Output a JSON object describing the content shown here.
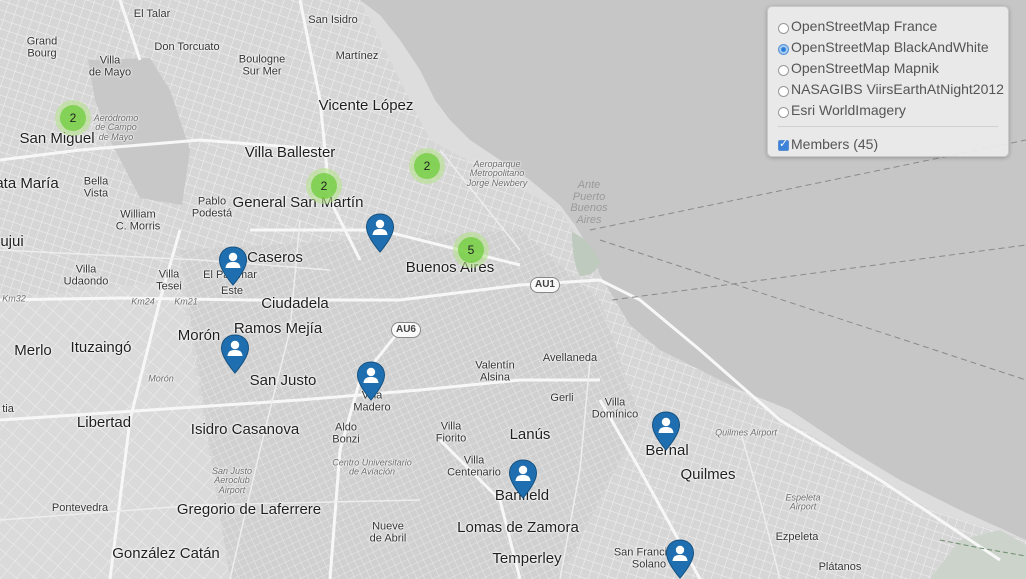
{
  "layers": {
    "base": [
      {
        "label": "OpenStreetMap France",
        "selected": false
      },
      {
        "label": "OpenStreetMap BlackAndWhite",
        "selected": true
      },
      {
        "label": "OpenStreetMap Mapnik",
        "selected": false
      },
      {
        "label": "NASAGIBS ViirsEarthAtNight2012",
        "selected": false
      },
      {
        "label": "Esri WorldImagery",
        "selected": false
      }
    ],
    "overlay": {
      "label": "Members (45)",
      "checked": true
    }
  },
  "map": {
    "places": [
      {
        "text": "El Talar",
        "size": "sm"
      },
      {
        "text": "San Isidro",
        "size": "sm"
      },
      {
        "text": "Grand\nBourg",
        "size": "sm"
      },
      {
        "text": "Don Torcuato",
        "size": "sm"
      },
      {
        "text": "Villa\nde Mayo",
        "size": "sm"
      },
      {
        "text": "Boulogne\nSur Mer",
        "size": "sm"
      },
      {
        "text": "Martínez",
        "size": "sm"
      },
      {
        "text": "Vicente López",
        "size": "lg"
      },
      {
        "text": "Aeródromo\nde Campo\nde Mayo",
        "size": "it"
      },
      {
        "text": "San Miguel",
        "size": "lg"
      },
      {
        "text": "Villa Ballester",
        "size": "lg"
      },
      {
        "text": "Aeroparque\nMetropolitano\nJorge Newbery",
        "size": "it"
      },
      {
        "text": "ata María",
        "size": "lg"
      },
      {
        "text": "Bella\nVista",
        "size": "sm"
      },
      {
        "text": "Pablo\nPodestá",
        "size": "sm"
      },
      {
        "text": "General San Martín",
        "size": "lg"
      },
      {
        "text": "Ante\nPuerto\nBuenos\nAires",
        "size": "water"
      },
      {
        "text": "William\nC. Morris",
        "size": "sm"
      },
      {
        "text": "Caseros",
        "size": "lg"
      },
      {
        "text": "Buenos Aires",
        "size": "lg"
      },
      {
        "text": "ujui",
        "size": "lg"
      },
      {
        "text": "Villa\nUdaondo",
        "size": "sm"
      },
      {
        "text": "Villa\nTesei",
        "size": "sm"
      },
      {
        "text": "El Palomar",
        "size": "sm"
      },
      {
        "text": "Este",
        "size": "sm"
      },
      {
        "text": "Km32",
        "size": "it"
      },
      {
        "text": "Km24",
        "size": "it"
      },
      {
        "text": "Km21",
        "size": "it"
      },
      {
        "text": "Ciudadela",
        "size": "lg"
      },
      {
        "text": "Ramos Mejía",
        "size": "lg"
      },
      {
        "text": "Morón",
        "size": "lg"
      },
      {
        "text": "Merlo",
        "size": "lg"
      },
      {
        "text": "Ituzaingó",
        "size": "lg"
      },
      {
        "text": "Morón",
        "size": "it"
      },
      {
        "text": "San Justo",
        "size": "lg"
      },
      {
        "text": "Valentín\nAlsina",
        "size": "sm"
      },
      {
        "text": "Avellaneda",
        "size": "sm"
      },
      {
        "text": "Villa\nMadero",
        "size": "sm"
      },
      {
        "text": "Gerli",
        "size": "sm"
      },
      {
        "text": "Villa\nDomínico",
        "size": "sm"
      },
      {
        "text": "tia",
        "size": "sm"
      },
      {
        "text": "Libertad",
        "size": "lg"
      },
      {
        "text": "Isidro Casanova",
        "size": "lg"
      },
      {
        "text": "Aldo\nBonzi",
        "size": "sm"
      },
      {
        "text": "Villa\nFiorito",
        "size": "sm"
      },
      {
        "text": "Lanús",
        "size": "lg"
      },
      {
        "text": "Bernal",
        "size": "lg"
      },
      {
        "text": "Quilmes Airport",
        "size": "it"
      },
      {
        "text": "Centro Universitario\nde Aviación",
        "size": "it"
      },
      {
        "text": "Villa\nCentenario",
        "size": "sm"
      },
      {
        "text": "Quilmes",
        "size": "lg"
      },
      {
        "text": "Banfield",
        "size": "lg"
      },
      {
        "text": "San Justo\nAeroclub\nAirport",
        "size": "it"
      },
      {
        "text": "Pontevedra",
        "size": "sm"
      },
      {
        "text": "Gregorio de Laferrere",
        "size": "lg"
      },
      {
        "text": "Lomas de Zamora",
        "size": "lg"
      },
      {
        "text": "Espeleta\nAirport",
        "size": "it"
      },
      {
        "text": "Nueve\nde Abril",
        "size": "sm"
      },
      {
        "text": "Ezpeleta",
        "size": "sm"
      },
      {
        "text": "González Catán",
        "size": "lg"
      },
      {
        "text": "Temperley",
        "size": "lg"
      },
      {
        "text": "San Francisco\nSolano",
        "size": "sm"
      },
      {
        "text": "Plátanos",
        "size": "sm"
      }
    ],
    "road_shields": [
      "AU1",
      "AU6"
    ],
    "clusters": [
      "2",
      "2",
      "2",
      "5"
    ],
    "markers": [
      "member",
      "member",
      "member",
      "member",
      "member",
      "member",
      "member"
    ]
  },
  "colors": {
    "river": "#c3c3c3",
    "land": "#dedede",
    "park": "#cfd7cf",
    "cluster_outer": "#b5e28c",
    "cluster_inner": "#6ecc39",
    "marker": "#1f6fb0"
  }
}
